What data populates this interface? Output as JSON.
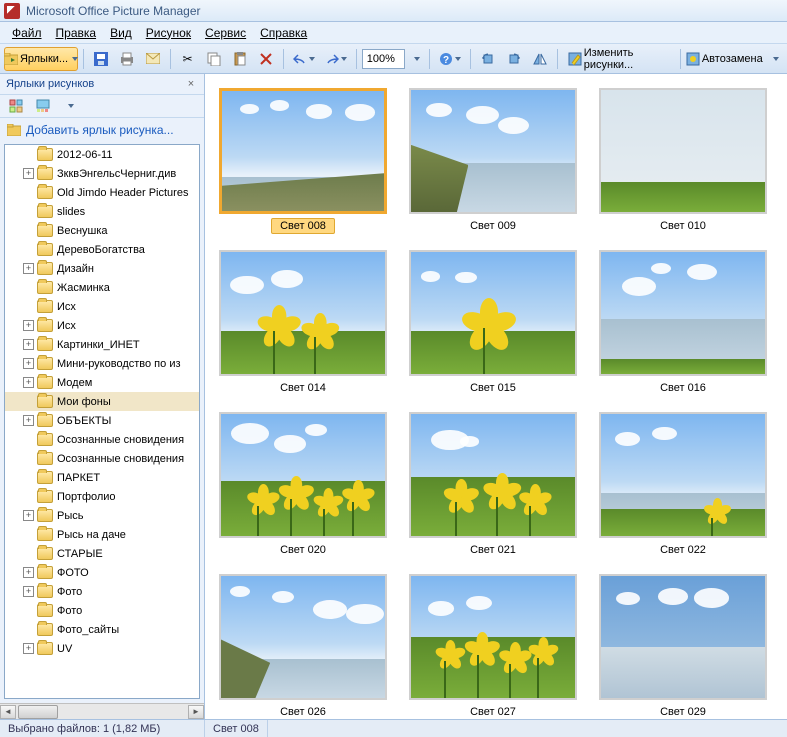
{
  "title": "Microsoft Office Picture Manager",
  "menu": {
    "file": "Файл",
    "edit": "Правка",
    "view": "Вид",
    "picture": "Рисунок",
    "tools": "Сервис",
    "help": "Справка"
  },
  "toolbar": {
    "shortcuts": "Ярлыки...",
    "zoom": "100%",
    "edit_pics": "Изменить рисунки...",
    "auto_correct": "Автозамена"
  },
  "sidebar": {
    "title": "Ярлыки рисунков",
    "add_link": "Добавить ярлык рисунка...",
    "items": [
      {
        "label": "2012-06-11",
        "depth": 1,
        "expandable": false
      },
      {
        "label": "ЗкквЭнгельсЧерниг.див",
        "depth": 1,
        "expandable": true
      },
      {
        "label": "Old Jimdo Header Pictures",
        "depth": 1,
        "expandable": false
      },
      {
        "label": "slides",
        "depth": 1,
        "expandable": false
      },
      {
        "label": "Веснушка",
        "depth": 1,
        "expandable": false
      },
      {
        "label": "ДеревоБогатства",
        "depth": 1,
        "expandable": false
      },
      {
        "label": "Дизайн",
        "depth": 1,
        "expandable": true
      },
      {
        "label": "Жасминка",
        "depth": 1,
        "expandable": false
      },
      {
        "label": "Исх",
        "depth": 1,
        "expandable": false
      },
      {
        "label": "Исх",
        "depth": 1,
        "expandable": true
      },
      {
        "label": "Картинки_ИНЕТ",
        "depth": 1,
        "expandable": true
      },
      {
        "label": "Мини-руководство по из",
        "depth": 1,
        "expandable": true
      },
      {
        "label": "Модем",
        "depth": 1,
        "expandable": true
      },
      {
        "label": "Мои фоны",
        "depth": 1,
        "expandable": false,
        "selected": true
      },
      {
        "label": "ОБЪЕКТЫ",
        "depth": 1,
        "expandable": true
      },
      {
        "label": "Осознанные сновидения",
        "depth": 1,
        "expandable": false
      },
      {
        "label": "Осознанные сновидения",
        "depth": 1,
        "expandable": false
      },
      {
        "label": "ПАРКЕТ",
        "depth": 1,
        "expandable": false
      },
      {
        "label": "Портфолио",
        "depth": 1,
        "expandable": false
      },
      {
        "label": "Рысь",
        "depth": 1,
        "expandable": true
      },
      {
        "label": "Рысь на даче",
        "depth": 1,
        "expandable": false
      },
      {
        "label": "СТАРЫЕ",
        "depth": 1,
        "expandable": false
      },
      {
        "label": "ФОТО",
        "depth": 1,
        "expandable": true
      },
      {
        "label": "Фото",
        "depth": 1,
        "expandable": true
      },
      {
        "label": "Фото",
        "depth": 1,
        "expandable": false
      },
      {
        "label": "Фото_сайты",
        "depth": 1,
        "expandable": false
      },
      {
        "label": "UV",
        "depth": 1,
        "expandable": true
      }
    ]
  },
  "thumbs": [
    {
      "label": "Свет 008",
      "selected": true,
      "type": "shore"
    },
    {
      "label": "Свет 009",
      "type": "cliff"
    },
    {
      "label": "Свет 010",
      "type": "mist"
    },
    {
      "label": "Свет 014",
      "type": "flower2"
    },
    {
      "label": "Свет 015",
      "type": "flower1"
    },
    {
      "label": "Свет 016",
      "type": "sea"
    },
    {
      "label": "Свет 020",
      "type": "meadow"
    },
    {
      "label": "Свет 021",
      "type": "meadow2"
    },
    {
      "label": "Свет 022",
      "type": "grass_sea"
    },
    {
      "label": "Свет 026",
      "type": "cliff2"
    },
    {
      "label": "Свет 027",
      "type": "meadow3"
    },
    {
      "label": "Свет 029",
      "type": "ice"
    }
  ],
  "status": {
    "selected": "Выбрано файлов: 1 (1,82 МБ)",
    "current": "Свет 008"
  }
}
